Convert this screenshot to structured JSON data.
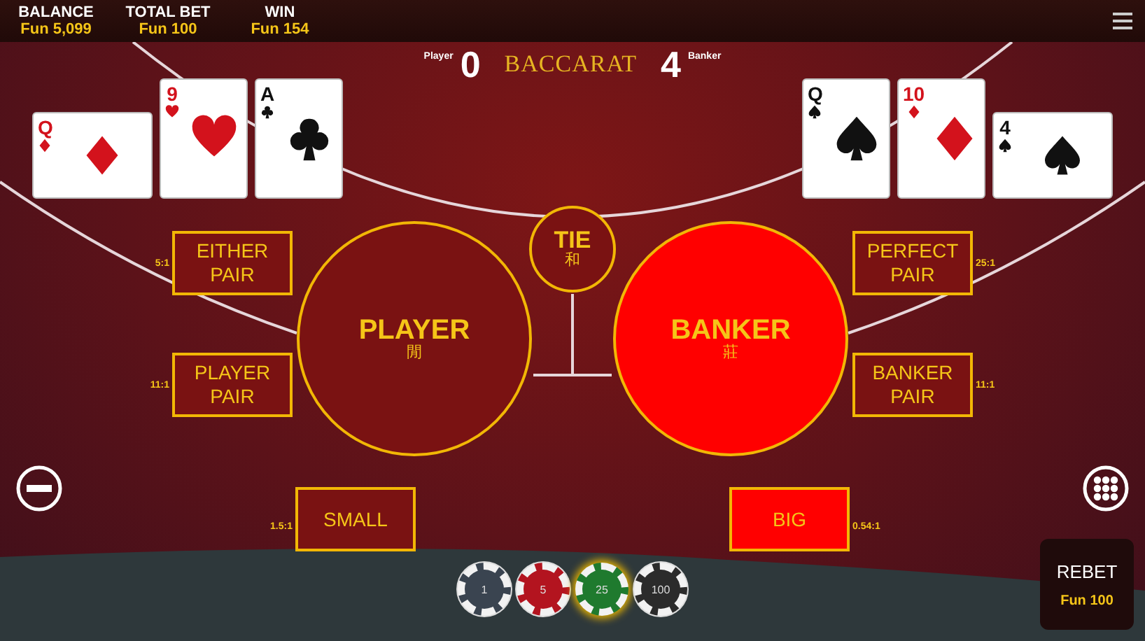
{
  "top_bar": {
    "stats": [
      {
        "label": "BALANCE",
        "value": "Fun 5,099"
      },
      {
        "label": "TOTAL BET",
        "value": "Fun 100"
      },
      {
        "label": "WIN",
        "value": "Fun 154"
      }
    ]
  },
  "scoreboard": {
    "player_label": "Player",
    "player_score": "0",
    "title": "BACCARAT",
    "banker_score": "4",
    "banker_label": "Banker"
  },
  "player_cards": [
    {
      "rank": "Q",
      "kind": "diamonds",
      "sideways": true
    },
    {
      "rank": "9",
      "kind": "hearts",
      "sideways": false
    },
    {
      "rank": "A",
      "kind": "clubs",
      "sideways": false
    }
  ],
  "banker_cards": [
    {
      "rank": "Q",
      "kind": "spades",
      "sideways": false
    },
    {
      "rank": "10",
      "kind": "diamonds",
      "sideways": false
    },
    {
      "rank": "4",
      "kind": "spades",
      "sideways": true
    }
  ],
  "side_bets_left": [
    {
      "label": "EITHER PAIR",
      "odds": "5:1",
      "highlighted": false
    },
    {
      "label": "PLAYER PAIR",
      "odds": "11:1",
      "highlighted": false
    }
  ],
  "main_bets": [
    {
      "label": "PLAYER",
      "subtitle": "閒",
      "highlighted": false
    },
    {
      "label": "TIE",
      "subtitle": "和",
      "highlighted": false
    },
    {
      "label": "BANKER",
      "subtitle": "莊",
      "highlighted": true
    }
  ],
  "side_bets_right": [
    {
      "label": "PERFECT PAIR",
      "odds": "25:1",
      "highlighted": false
    },
    {
      "label": "BANKER PAIR",
      "odds": "11:1",
      "highlighted": false
    }
  ],
  "size_bets": [
    {
      "label": "SMALL",
      "odds": "1.5:1",
      "highlighted": false
    },
    {
      "label": "BIG",
      "odds": "0.54:1",
      "highlighted": true
    }
  ],
  "chips": [
    {
      "value": "1",
      "color": "#3a4450",
      "selected": false
    },
    {
      "value": "5",
      "color": "#b3141f",
      "selected": false
    },
    {
      "value": "25",
      "color": "#1f7a2e",
      "selected": true
    },
    {
      "value": "100",
      "color": "#2b2b2b",
      "selected": false
    }
  ],
  "rebet": {
    "label": "REBET",
    "amount": "Fun 100"
  }
}
